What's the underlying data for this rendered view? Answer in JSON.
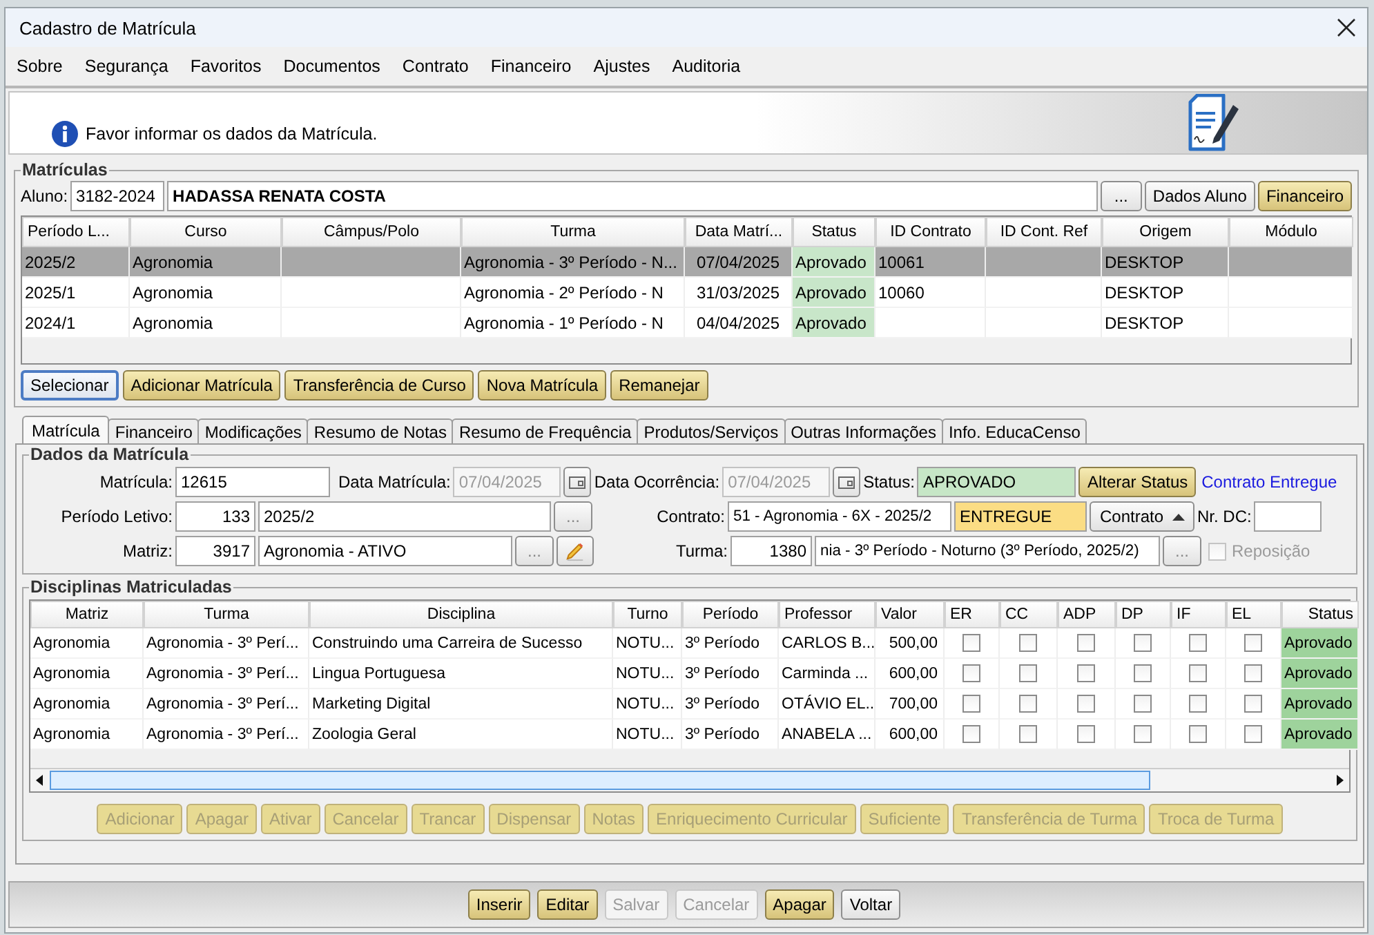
{
  "window": {
    "title": "Cadastro de Matrícula"
  },
  "menu": [
    "Sobre",
    "Segurança",
    "Favoritos",
    "Documentos",
    "Contrato",
    "Financeiro",
    "Ajustes",
    "Auditoria"
  ],
  "info_message": "Favor informar os dados da Matrícula.",
  "matriculas": {
    "title": "Matrículas",
    "aluno_label": "Aluno:",
    "aluno_code": "3182-2024",
    "aluno_name": "HADASSA RENATA COSTA",
    "aluno_buttons": [
      {
        "label": "...",
        "kind": "plain"
      },
      {
        "label": "Dados Aluno",
        "kind": "plain"
      },
      {
        "label": "Financeiro",
        "kind": "accent"
      }
    ],
    "columns": [
      {
        "label": "Período L...",
        "kind": "text"
      },
      {
        "label": "Curso",
        "kind": "text"
      },
      {
        "label": "Câmpus/Polo",
        "kind": "text"
      },
      {
        "label": "Turma",
        "kind": "text"
      },
      {
        "label": "Data Matrí...",
        "kind": "text"
      },
      {
        "label": "Status",
        "kind": "status"
      },
      {
        "label": "ID Contrato",
        "kind": "text"
      },
      {
        "label": "ID Cont. Ref",
        "kind": "text"
      },
      {
        "label": "Origem",
        "kind": "text"
      },
      {
        "label": "Módulo",
        "kind": "text"
      }
    ],
    "rows": [
      {
        "selected": true,
        "cells": [
          "2025/2",
          "Agronomia",
          null,
          "Agronomia - 3º Período - N...",
          "07/04/2025",
          "Aprovado",
          "10061",
          null,
          "DESKTOP",
          null
        ]
      },
      {
        "selected": false,
        "cells": [
          "2025/1",
          "Agronomia",
          null,
          "Agronomia - 2º Período - N",
          "31/03/2025",
          "Aprovado",
          "10060",
          null,
          "DESKTOP",
          null
        ]
      },
      {
        "selected": false,
        "cells": [
          "2024/1",
          "Agronomia",
          null,
          "Agronomia - 1º Período - N",
          "04/04/2025",
          "Aprovado",
          null,
          null,
          "DESKTOP",
          null
        ]
      }
    ],
    "buttons": [
      {
        "label": "Selecionar",
        "kind": "default"
      },
      {
        "label": "Adicionar Matrícula",
        "kind": "accent"
      },
      {
        "label": "Transferência de Curso",
        "kind": "accent"
      },
      {
        "label": "Nova Matrícula",
        "kind": "accent"
      },
      {
        "label": "Remanejar",
        "kind": "accent"
      }
    ]
  },
  "tabs": [
    {
      "label": "Matrícula",
      "selected": true
    },
    {
      "label": "Financeiro",
      "selected": false
    },
    {
      "label": "Modificações",
      "selected": false
    },
    {
      "label": "Resumo de Notas",
      "selected": false
    },
    {
      "label": "Resumo de Frequência",
      "selected": false
    },
    {
      "label": "Produtos/Serviços",
      "selected": false
    },
    {
      "label": "Outras Informações",
      "selected": false
    },
    {
      "label": "Info. EducaCenso",
      "selected": false
    }
  ],
  "dados_matricula": {
    "title": "Dados da Matrícula",
    "matricula": {
      "label": "Matrícula:",
      "value": "12615"
    },
    "data_matricula": {
      "label": "Data Matrícula:",
      "value": "07/04/2025",
      "disabled": true
    },
    "data_ocorrencia": {
      "label": "Data Ocorrência:",
      "value": "07/04/2025",
      "disabled": true
    },
    "status": {
      "label": "Status:",
      "value": "APROVADO",
      "button": "Alterar Status",
      "link": "Contrato Entregue"
    },
    "periodo_letivo": {
      "label": "Período Letivo:",
      "code": "133",
      "value": "2025/2",
      "browse": "..."
    },
    "contrato": {
      "label": "Contrato:",
      "value": "51 - Agronomia - 6X - 2025/2",
      "state": "ENTREGUE",
      "button": "Contrato"
    },
    "nr_dc": {
      "label": "Nr. DC:"
    },
    "matriz": {
      "label": "Matriz:",
      "code": "3917",
      "value": "Agronomia - ATIVO",
      "browse": "..."
    },
    "turma": {
      "label": "Turma:",
      "code": "1380",
      "value": "nia - 3º Período - Noturno (3º Período, 2025/2)",
      "browse": "...",
      "browse_disabled": true
    },
    "reposicao": {
      "label": "Reposição",
      "checked": false,
      "disabled": true
    }
  },
  "disciplinas": {
    "title": "Disciplinas Matriculadas",
    "columns": [
      {
        "label": "Matriz",
        "kind": "text"
      },
      {
        "label": "Turma",
        "kind": "text"
      },
      {
        "label": "Disciplina",
        "kind": "text"
      },
      {
        "label": "Turno",
        "kind": "text"
      },
      {
        "label": "Período",
        "kind": "text"
      },
      {
        "label": "Professor",
        "kind": "text"
      },
      {
        "label": "Valor",
        "kind": "number"
      },
      {
        "label": "ER",
        "kind": "check"
      },
      {
        "label": "CC",
        "kind": "check"
      },
      {
        "label": "ADP",
        "kind": "check"
      },
      {
        "label": "DP",
        "kind": "check"
      },
      {
        "label": "IF",
        "kind": "check"
      },
      {
        "label": "EL",
        "kind": "check"
      },
      {
        "label": "Status",
        "kind": "status"
      }
    ],
    "rows": [
      {
        "cells": [
          "Agronomia",
          "Agronomia - 3º Perí...",
          "Construindo uma Carreira de Sucesso",
          "NOTU...",
          "3º Período",
          "CARLOS B...",
          "500,00",
          {
            "checked": false
          },
          {
            "checked": false
          },
          {
            "checked": false
          },
          {
            "checked": false
          },
          {
            "checked": false
          },
          {
            "checked": false
          },
          "Aprovado"
        ]
      },
      {
        "cells": [
          "Agronomia",
          "Agronomia - 3º Perí...",
          "Lingua Portuguesa",
          "NOTU...",
          "3º Período",
          "Carminda ...",
          "600,00",
          {
            "checked": false
          },
          {
            "checked": false
          },
          {
            "checked": false
          },
          {
            "checked": false
          },
          {
            "checked": false
          },
          {
            "checked": false
          },
          "Aprovado"
        ]
      },
      {
        "cells": [
          "Agronomia",
          "Agronomia - 3º Perí...",
          "Marketing Digital",
          "NOTU...",
          "3º Período",
          "OTÁVIO EL...",
          "700,00",
          {
            "checked": false
          },
          {
            "checked": false
          },
          {
            "checked": false
          },
          {
            "checked": false
          },
          {
            "checked": false
          },
          {
            "checked": false
          },
          "Aprovado"
        ]
      },
      {
        "cells": [
          "Agronomia",
          "Agronomia - 3º Perí...",
          "Zoologia Geral",
          "NOTU...",
          "3º Período",
          "ANABELA ...",
          "600,00",
          {
            "checked": false
          },
          {
            "checked": false
          },
          {
            "checked": false
          },
          {
            "checked": false
          },
          {
            "checked": false
          },
          {
            "checked": false
          },
          "Aprovado"
        ]
      }
    ],
    "buttons": [
      {
        "label": "Adicionar",
        "disabled": true
      },
      {
        "label": "Apagar",
        "disabled": true
      },
      {
        "label": "Ativar",
        "disabled": true
      },
      {
        "label": "Cancelar",
        "disabled": true
      },
      {
        "label": "Trancar",
        "disabled": true
      },
      {
        "label": "Dispensar",
        "disabled": true
      },
      {
        "label": "Notas",
        "disabled": true
      },
      {
        "label": "Enriquecimento Curricular",
        "disabled": true
      },
      {
        "label": "Suficiente",
        "disabled": true
      },
      {
        "label": "Transferência de Turma",
        "disabled": true
      },
      {
        "label": "Troca de Turma",
        "disabled": true
      }
    ]
  },
  "footer_buttons": [
    {
      "label": "Inserir",
      "kind": "accent",
      "disabled": false
    },
    {
      "label": "Editar",
      "kind": "accent",
      "disabled": false
    },
    {
      "label": "Salvar",
      "kind": "plain",
      "disabled": true
    },
    {
      "label": "Cancelar",
      "kind": "plain",
      "disabled": true
    },
    {
      "label": "Apagar",
      "kind": "accent",
      "disabled": false
    },
    {
      "label": "Voltar",
      "kind": "plain",
      "disabled": false
    }
  ]
}
